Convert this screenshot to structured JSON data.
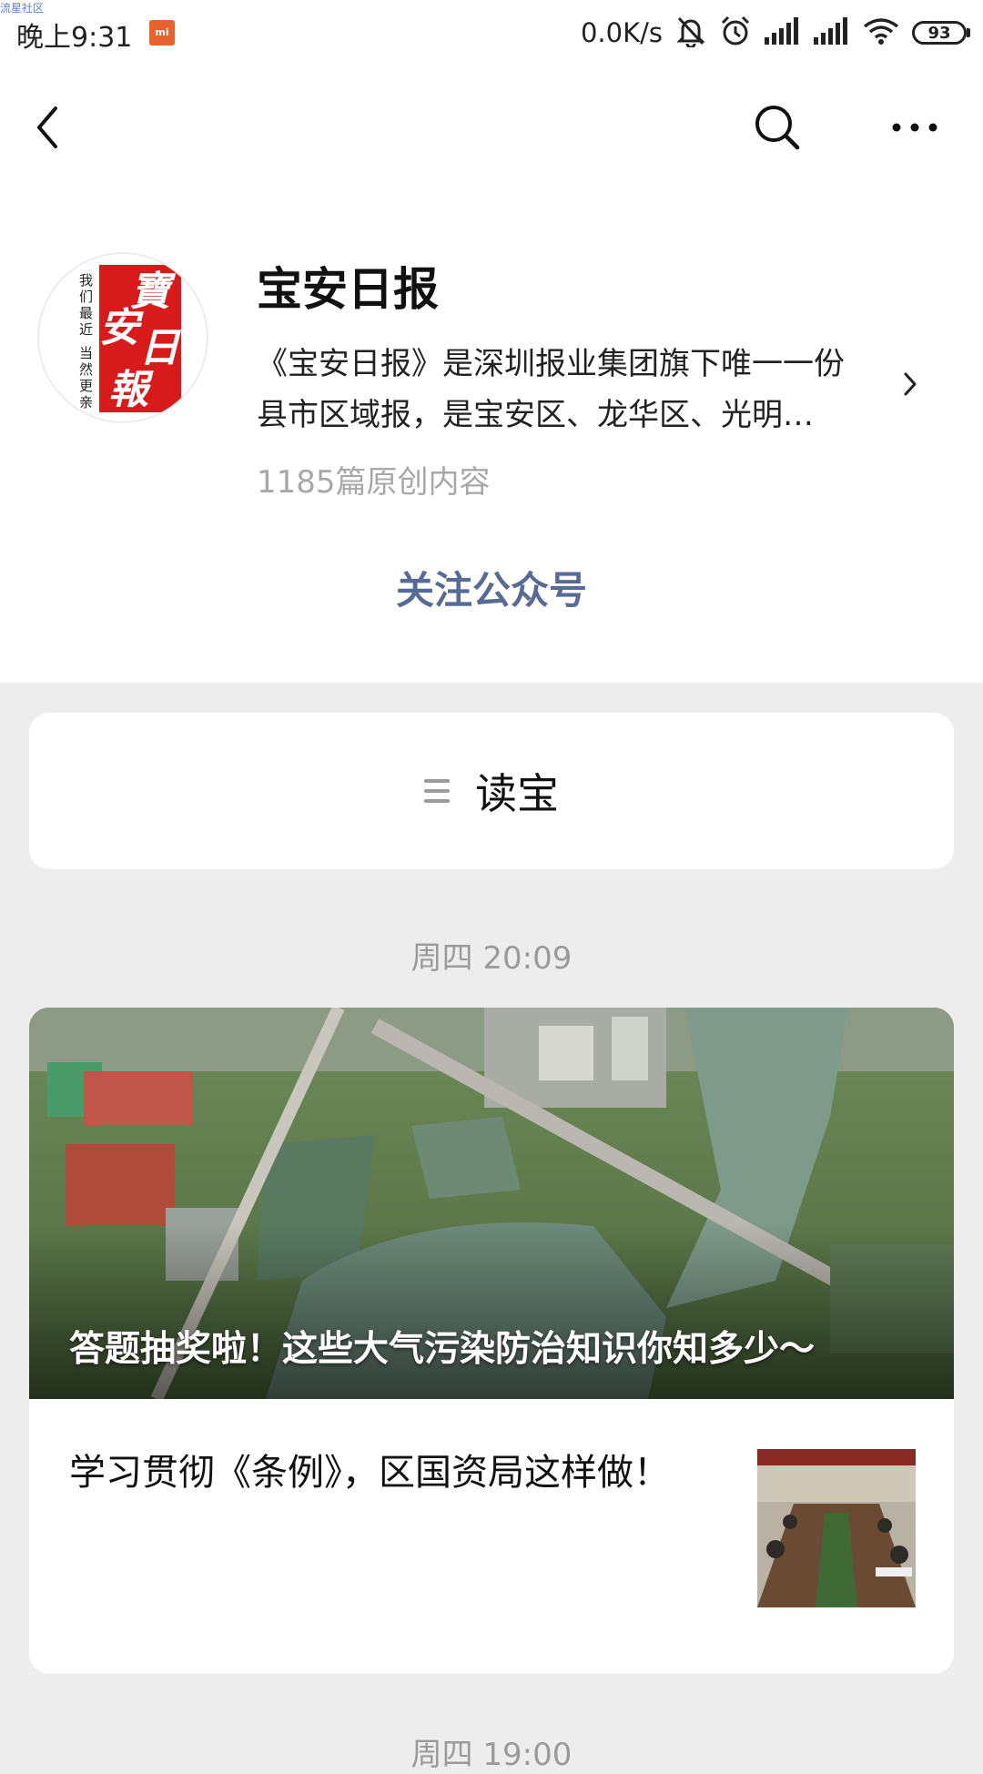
{
  "status_bar": {
    "watermark": "流星社区",
    "time": "晚上9:31",
    "mi_badge": "mi",
    "net_speed": "0.0K/s",
    "battery": "93"
  },
  "profile": {
    "name": "宝安日报",
    "description_line1": "《宝安日报》是深圳报业集团旗下唯一一份",
    "description_line2": "县市区域报，是宝安区、龙华区、光明…",
    "original_count": "1185篇原创内容",
    "follow_label": "关注公众号",
    "logo_text": "寶安日報",
    "logo_slogan_1": "我们最近",
    "logo_slogan_2": "当然更亲"
  },
  "menu": {
    "label": "读宝"
  },
  "feed": {
    "timestamp_1": "周四 20:09",
    "timestamp_2": "周四 19:00",
    "lead_article_title": "答题抽奖啦！这些大气污染防治知识你知多少～",
    "second_article_title": "学习贯彻《条例》，区国资局这样做！"
  },
  "colors": {
    "accent_link": "#576b95",
    "logo_red": "#d71a1a",
    "page_bg": "#ededed"
  }
}
